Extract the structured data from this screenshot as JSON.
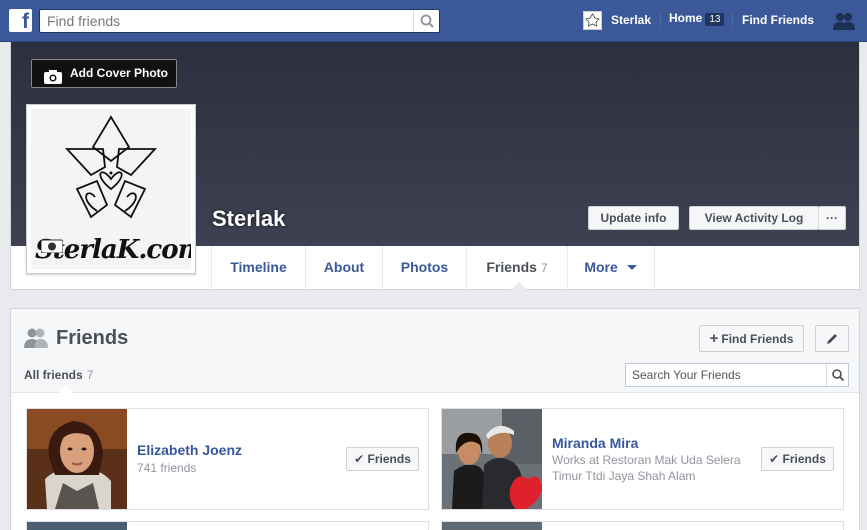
{
  "topbar": {
    "search_placeholder": "Find friends",
    "profile_name": "Sterlak",
    "home_label": "Home",
    "home_badge": "13",
    "find_friends_label": "Find Friends"
  },
  "cover": {
    "add_cover_label": "Add Cover Photo",
    "profile_name": "Sterlak",
    "profile_pic_text": "SterlaK.com",
    "update_info_label": "Update info",
    "activity_log_label": "View Activity Log",
    "more_dots": "···"
  },
  "tabs": [
    {
      "label": "Timeline"
    },
    {
      "label": "About"
    },
    {
      "label": "Photos"
    },
    {
      "label": "Friends",
      "count": "7"
    },
    {
      "label": "More"
    }
  ],
  "friends_section": {
    "title": "Friends",
    "find_friends_label": "Find Friends",
    "all_friends_label": "All friends",
    "all_friends_count": "7",
    "search_placeholder": "Search Your Friends"
  },
  "friends": [
    {
      "name": "Elizabeth Joenz",
      "sub": "741 friends",
      "button": "Friends"
    },
    {
      "name": "Miranda Mira",
      "sub1": "Works at Restoran Mak Uda Selera",
      "sub2": "Timur Ttdi Jaya Shah Alam",
      "button": "Friends"
    }
  ],
  "colors": {
    "brand": "#3b5998",
    "link": "#365899",
    "cover_bg": "#2c2f3d"
  }
}
